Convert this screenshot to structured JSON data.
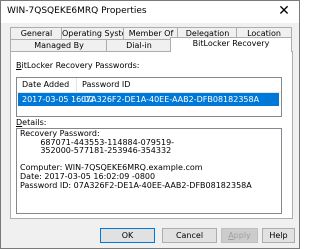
{
  "window": {
    "title": "WIN-7QSQEKE6MRQ Properties",
    "close_glyph": "✕"
  },
  "tabs_row1": [
    {
      "label": "General"
    },
    {
      "label": "Operating System"
    },
    {
      "label": "Member Of"
    },
    {
      "label": "Delegation"
    },
    {
      "label": "Location"
    }
  ],
  "tabs_row2": [
    {
      "label": "Managed By"
    },
    {
      "label": "Dial-in"
    },
    {
      "label": "BitLocker Recovery",
      "active": true
    }
  ],
  "bitlocker": {
    "passwords_label_first": "B",
    "passwords_label_rest": "itLocker Recovery Passwords:",
    "columns": [
      "Date Added",
      "Password ID"
    ],
    "rows": [
      {
        "date_added": "2017-03-05 16:02",
        "password_id": "07A326F2-DE1A-40EE-AAB2-DFB08182358A",
        "selected": true
      }
    ],
    "details_label_first": "D",
    "details_label_rest": "etails:",
    "details_text": "Recovery Password:\n        687071-443553-114884-079519-\n        352000-577181-253946-354332\n\nComputer: WIN-7QSQEKE6MRQ.example.com\nDate: 2017-03-05 16:02:09 -0800\nPassword ID: 07A326F2-DE1A-40EE-AAB2-DFB08182358A"
  },
  "buttons": {
    "ok": "OK",
    "cancel": "Cancel",
    "apply_first": "A",
    "apply_rest": "pply",
    "help": "Help"
  },
  "colors": {
    "selection": "#0078d7",
    "dialog_bg": "#f0f0f0"
  }
}
